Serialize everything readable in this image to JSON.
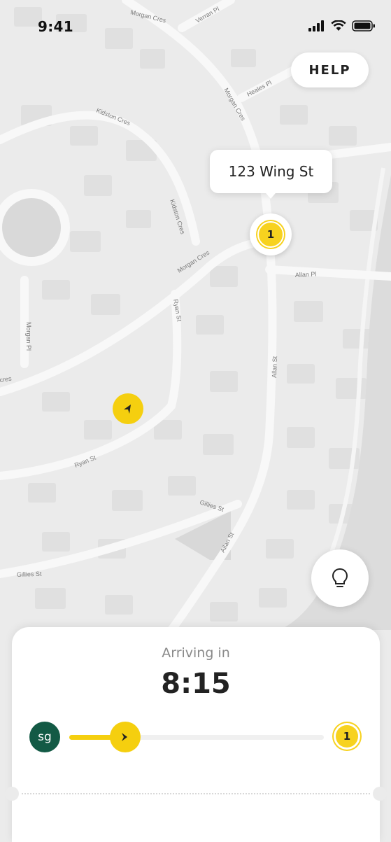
{
  "status_bar": {
    "time": "9:41"
  },
  "help_button": {
    "label": "HELP"
  },
  "destination": {
    "address": "123 Wing St",
    "stop_number": "1"
  },
  "map": {
    "streets": {
      "morgan_cres_top": "Morgan Cres",
      "verran_pl": "Verran Pl",
      "heales_pl": "Heales Pl",
      "morgan_cres_right": "Morgan Cres",
      "kidston_cres_top": "Kidston Cres",
      "kidston_cres_right": "Kidston Cres",
      "morgan_cres_middle": "Morgan Cres",
      "allan_pl": "Allan Pl",
      "ryan_st_vertical": "Ryan St",
      "morgan_pl": "Morgan Pl",
      "allan_st_vertical": "Allan St",
      "cres_fragment": "cres",
      "ryan_st_bottom": "Ryan St",
      "gillies_st_right": "Gillies St",
      "allan_st_bottom": "Allan St",
      "gillies_st_left": "Gillies St"
    },
    "icons": {
      "vehicle": "navigation-arrow-icon",
      "tip": "lightbulb-icon"
    }
  },
  "trip_sheet": {
    "arriving_label": "Arriving in",
    "eta": "8:15",
    "driver_initials": "sg",
    "progress": 0.22,
    "end_stop_number": "1"
  },
  "colors": {
    "accent": "#f5cf0f",
    "avatar": "#135a45",
    "map_bg": "#ebebeb"
  }
}
